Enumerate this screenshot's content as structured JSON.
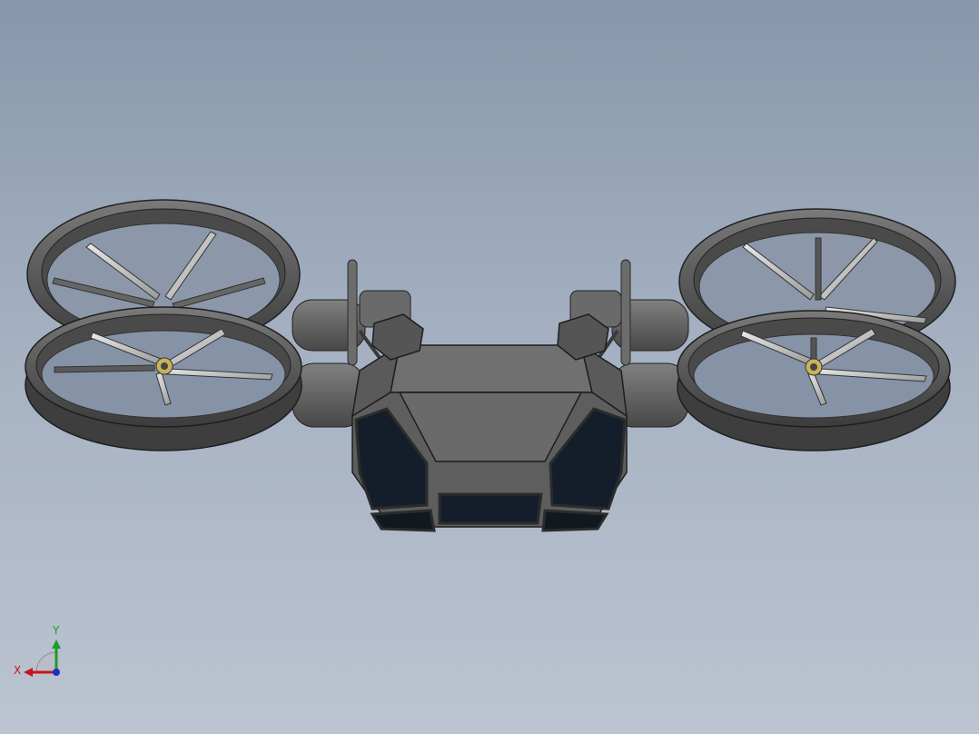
{
  "viewport": {
    "background_top": "#8797ab",
    "background_bottom": "#bcc4d1"
  },
  "model": {
    "body_color": "#5e5e5e",
    "window_color": "#141e2a",
    "rotor_count": 4
  },
  "triad": {
    "x_label": "X",
    "y_label": "Y",
    "x_color": "#c8151b",
    "y_color": "#1e9b2a",
    "z_color": "#1c2fc4"
  }
}
